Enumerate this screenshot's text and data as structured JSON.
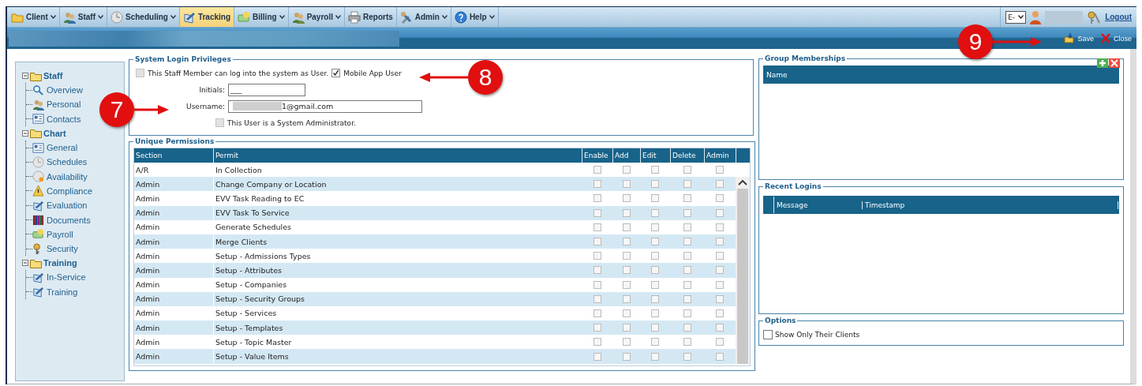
{
  "menu": [
    {
      "label": "Client",
      "has_menu": true,
      "selected": false
    },
    {
      "label": "Staff",
      "has_menu": true,
      "selected": false
    },
    {
      "label": "Scheduling",
      "has_menu": true,
      "selected": false
    },
    {
      "label": "Tracking",
      "has_menu": false,
      "selected": true
    },
    {
      "label": "Billing",
      "has_menu": true,
      "selected": false
    },
    {
      "label": "Payroll",
      "has_menu": true,
      "selected": false
    },
    {
      "label": "Reports",
      "has_menu": false,
      "selected": false
    },
    {
      "label": "Admin",
      "has_menu": true,
      "selected": false
    },
    {
      "label": "Help",
      "has_menu": true,
      "selected": false
    }
  ],
  "language": "E-",
  "logout": "Logout",
  "actions": [
    {
      "label": "Save"
    },
    {
      "label": "Close"
    }
  ],
  "sidebar": {
    "items": [
      {
        "label": "Staff",
        "expanded": true,
        "children": [
          {
            "label": "Overview"
          },
          {
            "label": "Personal"
          },
          {
            "label": "Contacts"
          }
        ]
      },
      {
        "label": "Chart",
        "expanded": true,
        "children": [
          {
            "label": "General"
          },
          {
            "label": "Schedules"
          },
          {
            "label": "Availability"
          },
          {
            "label": "Compliance"
          },
          {
            "label": "Evaluation"
          },
          {
            "label": "Documents"
          },
          {
            "label": "Payroll"
          },
          {
            "label": "Security"
          }
        ]
      },
      {
        "label": "Training",
        "expanded": true,
        "children": [
          {
            "label": "In-Service"
          },
          {
            "label": "Training"
          }
        ]
      }
    ]
  },
  "login": {
    "title": "System Login Privileges",
    "can_login": {
      "label": "This Staff Member can log into the system as User.",
      "checked": false,
      "disabled": true
    },
    "mobile": {
      "label": "Mobile App User",
      "checked": true,
      "disabled": false
    },
    "initials": {
      "label": "Initials:",
      "value": "___"
    },
    "username": {
      "label": "Username:",
      "value": "1@gmail.com"
    },
    "admin": {
      "label": "This User is a System Administrator.",
      "checked": false,
      "disabled": true
    }
  },
  "permissions": {
    "title": "Unique Permissions",
    "columns": [
      "Section",
      "Permit",
      "Enable",
      "Add",
      "Edit",
      "Delete",
      "Admin"
    ],
    "rows": [
      {
        "section": "A/R",
        "permit": "In Collection",
        "checks": [
          false,
          false,
          false,
          false,
          false
        ]
      },
      {
        "section": "Admin",
        "permit": "Change Company or Location",
        "checks": [
          false,
          false,
          false,
          false,
          false
        ]
      },
      {
        "section": "Admin",
        "permit": "EVV Task Reading to EC",
        "checks": [
          false,
          false,
          false,
          false,
          false
        ]
      },
      {
        "section": "Admin",
        "permit": "EVV Task To Service",
        "checks": [
          false,
          false,
          false,
          false,
          false
        ]
      },
      {
        "section": "Admin",
        "permit": "Generate Schedules",
        "checks": [
          false,
          false,
          false,
          false,
          false
        ]
      },
      {
        "section": "Admin",
        "permit": "Merge Clients",
        "checks": [
          false,
          false,
          false,
          false,
          false
        ]
      },
      {
        "section": "Admin",
        "permit": "Setup - Admissions Types",
        "checks": [
          false,
          false,
          false,
          false,
          false
        ]
      },
      {
        "section": "Admin",
        "permit": "Setup - Attributes",
        "checks": [
          false,
          false,
          false,
          false,
          false
        ]
      },
      {
        "section": "Admin",
        "permit": "Setup - Companies",
        "checks": [
          false,
          false,
          false,
          false,
          false
        ]
      },
      {
        "section": "Admin",
        "permit": "Setup - Security Groups",
        "checks": [
          false,
          false,
          false,
          false,
          false
        ]
      },
      {
        "section": "Admin",
        "permit": "Setup - Services",
        "checks": [
          false,
          false,
          false,
          false,
          false
        ]
      },
      {
        "section": "Admin",
        "permit": "Setup - Templates",
        "checks": [
          false,
          false,
          false,
          false,
          false
        ]
      },
      {
        "section": "Admin",
        "permit": "Setup - Topic Master",
        "checks": [
          false,
          false,
          false,
          false,
          false
        ]
      },
      {
        "section": "Admin",
        "permit": "Setup - Value Items",
        "checks": [
          false,
          false,
          false,
          false,
          false
        ]
      }
    ]
  },
  "groups": {
    "title": "Group Memberships",
    "columns": [
      "Name"
    ]
  },
  "logins": {
    "title": "Recent Logins",
    "columns": [
      "Message",
      "Timestamp"
    ]
  },
  "options": {
    "title": "Options",
    "items": [
      {
        "label": "Show Only Their Clients",
        "checked": false
      }
    ]
  },
  "callouts": [
    {
      "number": "7"
    },
    {
      "number": "8"
    },
    {
      "number": "9"
    }
  ]
}
